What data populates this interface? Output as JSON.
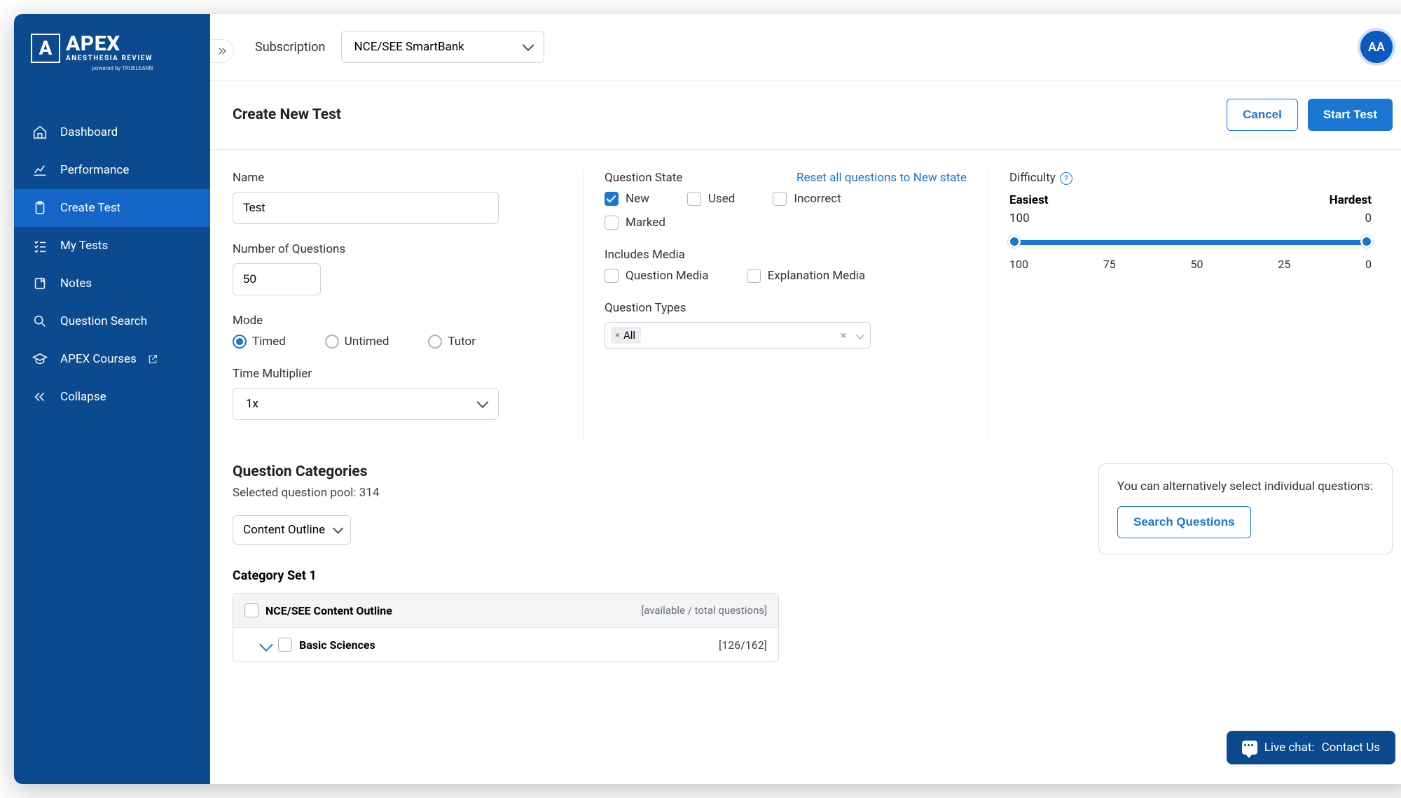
{
  "brand": {
    "name": "APEX",
    "sub": "ANESTHESIA REVIEW",
    "powered": "powered by TRUELEARN"
  },
  "avatar": "AA",
  "sidebar": {
    "items": [
      {
        "label": "Dashboard"
      },
      {
        "label": "Performance"
      },
      {
        "label": "Create Test"
      },
      {
        "label": "My Tests"
      },
      {
        "label": "Notes"
      },
      {
        "label": "Question Search"
      },
      {
        "label": "APEX Courses"
      },
      {
        "label": "Collapse"
      }
    ]
  },
  "topbar": {
    "subscription_label": "Subscription",
    "subscription_value": "NCE/SEE SmartBank"
  },
  "page": {
    "title": "Create New Test",
    "cancel": "Cancel",
    "start": "Start Test"
  },
  "form": {
    "name_label": "Name",
    "name_value": "Test",
    "numq_label": "Number of Questions",
    "numq_value": "50",
    "mode_label": "Mode",
    "mode_options": {
      "timed": "Timed",
      "untimed": "Untimed",
      "tutor": "Tutor"
    },
    "time_mult_label": "Time Multiplier",
    "time_mult_value": "1x",
    "qstate_label": "Question State",
    "reset_link": "Reset all questions to New state",
    "qstate": {
      "new": "New",
      "used": "Used",
      "incorrect": "Incorrect",
      "marked": "Marked"
    },
    "media_label": "Includes Media",
    "media": {
      "question": "Question Media",
      "explanation": "Explanation Media"
    },
    "qtypes_label": "Question Types",
    "qtypes_value": "All",
    "difficulty_label": "Difficulty",
    "diff": {
      "easiest": "Easiest",
      "hardest": "Hardest",
      "low": "100",
      "high": "0"
    },
    "diff_ticks": [
      "100",
      "75",
      "50",
      "25",
      "0"
    ]
  },
  "qc": {
    "title": "Question Categories",
    "pool_label": "Selected question pool: 314",
    "dropdown": "Content Outline",
    "alt_text": "You can alternatively select individual questions:",
    "alt_btn": "Search Questions",
    "set_title": "Category Set 1",
    "outline_name": "NCE/SEE Content Outline",
    "outline_meta": "[available / total questions]",
    "row1_name": "Basic Sciences",
    "row1_count": "[126/162]"
  },
  "contact": {
    "label": "Live chat:",
    "btn": "Contact Us"
  }
}
